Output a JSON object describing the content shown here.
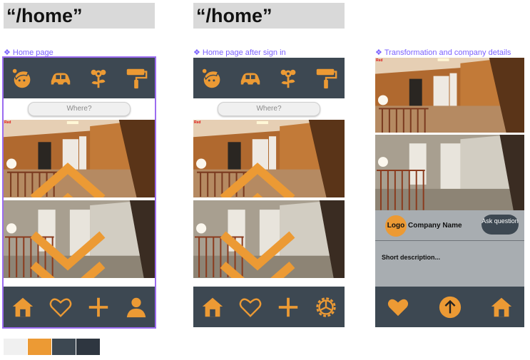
{
  "routes": [
    "“/home”",
    "“/home”"
  ],
  "frames": [
    {
      "label": "Home page",
      "search_placeholder": "Where?",
      "tag": "Red"
    },
    {
      "label": "Home page after sign in",
      "search_placeholder": "Where?",
      "tag": "Red"
    },
    {
      "label": "Transformation and company details",
      "tag": "Red",
      "logo": "Logo",
      "company_name": "Company Name",
      "ask_button": "Ask question",
      "description": "Short description..."
    }
  ],
  "icons": {
    "top": [
      "painter-face-icon",
      "car-icon",
      "flower-icon",
      "paint-roller-icon"
    ],
    "bottom_f1": [
      "home-icon",
      "heart-icon",
      "plus-icon",
      "user-icon"
    ],
    "bottom_f2": [
      "home-icon",
      "heart-icon",
      "plus-icon",
      "settings-icon"
    ],
    "bottom_f3": [
      "heart-icon",
      "upload-icon",
      "home-icon"
    ]
  },
  "colors": {
    "accent": "#ec9a34",
    "dark": "#3d4852",
    "gray": "#a8adb1",
    "selection": "#9b6cf0"
  },
  "palette": [
    "#f0f0f0",
    "#ec9a34",
    "#3d4852",
    "#2e3640"
  ]
}
